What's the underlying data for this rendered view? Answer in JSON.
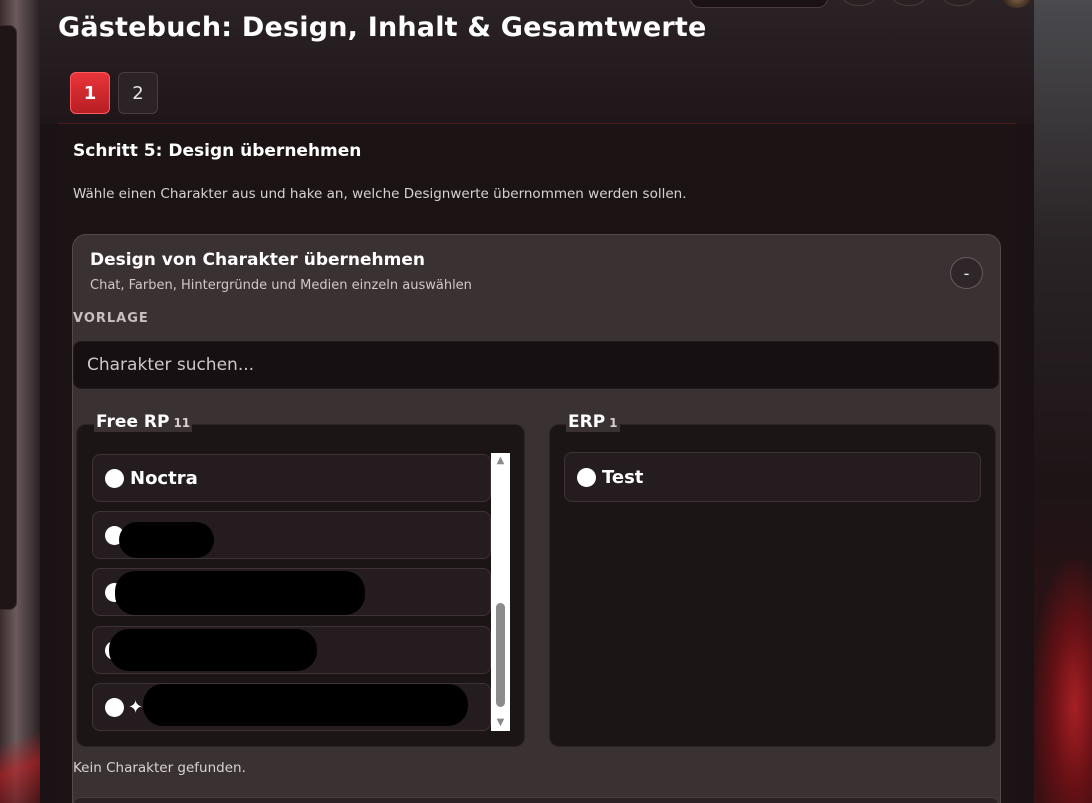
{
  "page": {
    "title": "Gästebuch: Design, Inhalt & Gesamtwerte"
  },
  "steps": [
    {
      "label": "1",
      "active": true
    },
    {
      "label": "2",
      "active": false
    }
  ],
  "step": {
    "heading": "Schritt 5: Design übernehmen",
    "description": "Wähle einen Charakter aus und hake an, welche Designwerte übernommen werden sollen."
  },
  "card": {
    "title": "Design von Charakter übernehmen",
    "subtitle": "Chat, Farben, Hintergründe und Medien einzeln auswählen",
    "collapse_label": "-",
    "template_label": "VORLAGE",
    "search_placeholder": "Charakter suchen..."
  },
  "groups": {
    "free_rp": {
      "label": "Free RP",
      "count": "11",
      "items": [
        {
          "name": "Noctra",
          "redacted": false
        },
        {
          "name": "",
          "redacted": true
        },
        {
          "name": "",
          "redacted": true
        },
        {
          "name": "",
          "redacted": true
        },
        {
          "name": "✦",
          "redacted": true
        }
      ]
    },
    "erp": {
      "label": "ERP",
      "count": "1",
      "items": [
        {
          "name": "Test",
          "redacted": false
        }
      ]
    }
  },
  "empty_message": "Kein Charakter gefunden.",
  "scrollbar": {
    "up_arrow": "▲",
    "down_arrow": "▼"
  }
}
